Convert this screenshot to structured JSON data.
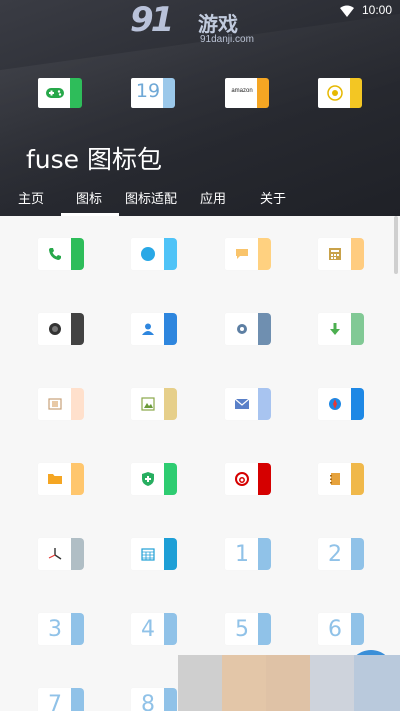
{
  "status_bar": {
    "time": "10:00"
  },
  "watermark": {
    "logo_text": "91",
    "cn_text": "游戏",
    "url": "91danji.com"
  },
  "app": {
    "title": "fuse 图标包"
  },
  "tabs": [
    {
      "label": "主页"
    },
    {
      "label": "图标",
      "active": true
    },
    {
      "label": "图标适配"
    },
    {
      "label": "应用"
    },
    {
      "label": "关于"
    }
  ],
  "preview_icons": [
    {
      "name": "game-controller-icon",
      "accent": "#2ebd5a"
    },
    {
      "name": "calendar-icon",
      "accent": "#9bc8ea",
      "text": "19"
    },
    {
      "name": "amazon-icon",
      "accent": "#f5a623",
      "text": "amazon"
    },
    {
      "name": "target-icon",
      "accent": "#f3c623"
    }
  ],
  "icons": [
    [
      {
        "name": "phone-icon",
        "accent": "#2ebd5a"
      },
      {
        "name": "chat-bubble-icon",
        "accent": "#4fc3f7"
      },
      {
        "name": "message-icon",
        "accent": "#ffd180"
      },
      {
        "name": "calculator-icon",
        "accent": "#ffcc80"
      }
    ],
    [
      {
        "name": "camera-icon",
        "accent": "#424242"
      },
      {
        "name": "contacts-icon",
        "accent": "#2e86de"
      },
      {
        "name": "settings-icon",
        "accent": "#6f8fb0"
      },
      {
        "name": "download-icon",
        "accent": "#81c995"
      }
    ],
    [
      {
        "name": "sim-card-icon",
        "accent": "#ffe0cc"
      },
      {
        "name": "image-icon",
        "accent": "#e6cf8a"
      },
      {
        "name": "mail-icon",
        "accent": "#a8c4f0"
      },
      {
        "name": "compass-icon",
        "accent": "#1e88e5"
      }
    ],
    [
      {
        "name": "folder-icon",
        "accent": "#ffc66d"
      },
      {
        "name": "shield-icon",
        "accent": "#2ecc71"
      },
      {
        "name": "netease-music-icon",
        "accent": "#d50000"
      },
      {
        "name": "notebook-icon",
        "accent": "#f0b84a"
      }
    ],
    [
      {
        "name": "clock-icon",
        "accent": "#b0bec5"
      },
      {
        "name": "calendar-grid-icon",
        "accent": "#1e9fd6"
      },
      {
        "name": "number-1-icon",
        "accent": "#90c2e8",
        "text": "1"
      },
      {
        "name": "number-2-icon",
        "accent": "#90c2e8",
        "text": "2"
      }
    ],
    [
      {
        "name": "number-3-icon",
        "accent": "#90c2e8",
        "text": "3"
      },
      {
        "name": "number-4-icon",
        "accent": "#90c2e8",
        "text": "4"
      },
      {
        "name": "number-5-icon",
        "accent": "#90c2e8",
        "text": "5"
      },
      {
        "name": "number-6-icon",
        "accent": "#90c2e8",
        "text": "6"
      }
    ],
    [
      {
        "name": "number-7-icon",
        "accent": "#90c2e8",
        "text": "7"
      },
      {
        "name": "number-8-icon",
        "accent": "#90c2e8",
        "text": "8"
      }
    ]
  ]
}
